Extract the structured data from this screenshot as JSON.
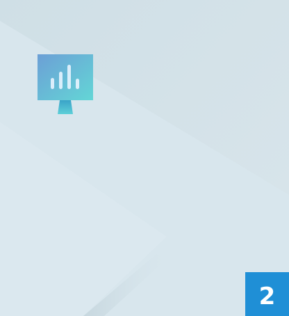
{
  "desktop": {
    "background_color": "#d4e3ea",
    "shape_colors": [
      "#dbe7ee",
      "#dde9ef",
      "#c6d6dd"
    ]
  },
  "monitor_icon": {
    "icon": "bar-chart-monitor-icon",
    "screen_gradient": [
      "#6c9fd6",
      "#63d6d6"
    ],
    "stand_color": "#4fc6d0"
  },
  "page_badge": {
    "value": "2",
    "color": "#1f8fd6"
  }
}
